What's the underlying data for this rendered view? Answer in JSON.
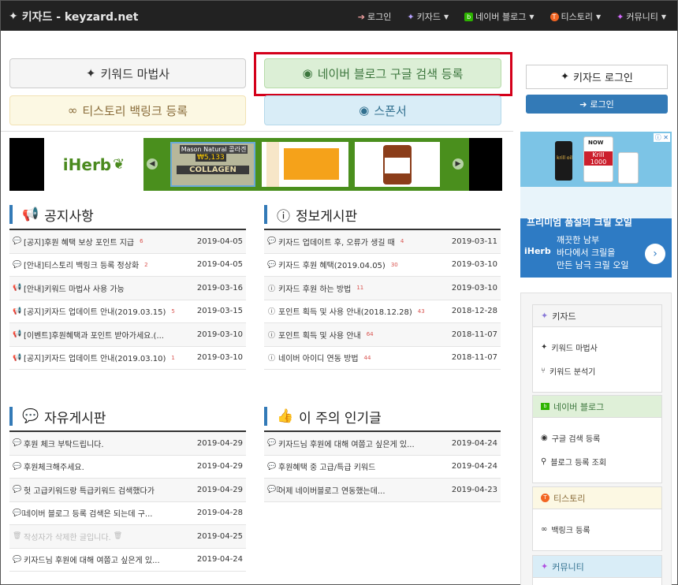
{
  "nav": {
    "brand": "키자드 - keyzard.net",
    "items": [
      {
        "label": "로그인",
        "icon": "sign-in-icon"
      },
      {
        "label": "키자드",
        "icon": "wand-icon"
      },
      {
        "label": "네이버 블로그",
        "icon": "naver-blog-icon"
      },
      {
        "label": "티스토리",
        "icon": "tistory-icon"
      },
      {
        "label": "커뮤니티",
        "icon": "community-icon"
      }
    ]
  },
  "buttons": {
    "wizard": "키워드 마법사",
    "naver": "네이버 블로그 구글 검색 등록",
    "tistory": "티스토리 백링크 등록",
    "sponsor": "스폰서"
  },
  "ad_banner": {
    "brand": "iHerb",
    "product_tag": "Mason Natural 콜라겐",
    "price": "₩5,133",
    "product_name": "COLLAGEN"
  },
  "notice": {
    "title": "공지사항",
    "rows": [
      {
        "text": "[공지]후원 혜택 보상 포인트 지급",
        "count": "6",
        "date": "2019-04-05",
        "icon": "comment-icon"
      },
      {
        "text": "[안내]티스토리 백링크 등록 정상화",
        "count": "2",
        "date": "2019-04-05",
        "icon": "comment-icon"
      },
      {
        "text": "[안내]키워드 마법사 사용 가능",
        "count": "",
        "date": "2019-03-16",
        "icon": "megaphone-icon"
      },
      {
        "text": "[공지]키자드 업데이트 안내(2019.03.15)",
        "count": "5",
        "date": "2019-03-15",
        "icon": "megaphone-icon"
      },
      {
        "text": "[이벤트]후원혜택과 포인트 받아가세요.(...",
        "count": "",
        "date": "2019-03-10",
        "icon": "megaphone-icon"
      },
      {
        "text": "[공지]키자드 업데이트 안내(2019.03.10)",
        "count": "1",
        "date": "2019-03-10",
        "icon": "megaphone-icon"
      }
    ]
  },
  "info": {
    "title": "정보게시판",
    "rows": [
      {
        "text": "키자드 업데이트 후, 오류가 생길 때",
        "count": "4",
        "date": "2019-03-11",
        "icon": "comment-icon"
      },
      {
        "text": "키자드 후원 혜택(2019.04.05)",
        "count": "30",
        "date": "2019-03-10",
        "icon": "comment-icon"
      },
      {
        "text": "키자드 후원 하는 방법",
        "count": "11",
        "date": "2019-03-10",
        "icon": "info-icon"
      },
      {
        "text": "포인트 획득 및 사용 안내(2018.12.28)",
        "count": "43",
        "date": "2018-12-28",
        "icon": "info-icon"
      },
      {
        "text": "포인트 획득 및 사용 안내",
        "count": "64",
        "date": "2018-11-07",
        "icon": "info-icon"
      },
      {
        "text": "네이버 아이디 연동 방법",
        "count": "44",
        "date": "2018-11-07",
        "icon": "info-icon"
      }
    ]
  },
  "free": {
    "title": "자유게시판",
    "rows": [
      {
        "text": "후원 체크 부탁드립니다.",
        "count": "",
        "date": "2019-04-29",
        "icon": "comment-icon"
      },
      {
        "text": "후원체크해주세요.",
        "count": "",
        "date": "2019-04-29",
        "icon": "comment-icon"
      },
      {
        "text": "헛 고급키워드랑 특급키워드 검색했다가",
        "count": "",
        "date": "2019-04-29",
        "icon": "comments-icon"
      },
      {
        "text": "네이버 블로그 등록 검색은 되는데 구...",
        "count": "",
        "date": "2019-04-28",
        "icon": "comments-mobile-icon"
      },
      {
        "text": "작성자가 삭제한 글입니다.",
        "count": "",
        "date": "2019-04-25",
        "icon": "trash-icon",
        "deleted": true
      },
      {
        "text": "키자드님 후원에 대해 여쭙고 싶은게 있...",
        "count": "",
        "date": "2019-04-24",
        "icon": "comments-icon"
      }
    ]
  },
  "popular": {
    "title": "이 주의 인기글",
    "rows": [
      {
        "text": "키자드님 후원에 대해 여쭙고 싶은게 있...",
        "count": "",
        "date": "2019-04-24",
        "icon": "comments-icon"
      },
      {
        "text": "후원혜택 중 고급/특급 키워드",
        "count": "",
        "date": "2019-04-24",
        "icon": "comments-icon"
      },
      {
        "text": "어제 네이버블로그 연동했는데...",
        "count": "",
        "date": "2019-04-23",
        "icon": "comments-mobile-icon"
      }
    ]
  },
  "side": {
    "login_title": "키자드 로그인",
    "login_button": "로그인",
    "ad": {
      "headline": "프리미엄 품질의 크릴 오일",
      "lines": [
        "깨끗한 남부",
        "바다에서 크릴을",
        "만든 남극 크릴 오일"
      ],
      "brand": "iHerb",
      "bottle_labels": [
        "NOW",
        "krill oil",
        "Krill 1000"
      ]
    },
    "panels": [
      {
        "title": "키자드",
        "items": [
          "키워드 마법사",
          "키워드 분석기"
        ]
      },
      {
        "title": "네이버 블로그",
        "items": [
          "구글 검색 등록",
          "블로그 등록 조회"
        ]
      },
      {
        "title": "티스토리",
        "items": [
          "백링크 등록"
        ]
      },
      {
        "title": "커뮤니티",
        "items": []
      }
    ]
  }
}
